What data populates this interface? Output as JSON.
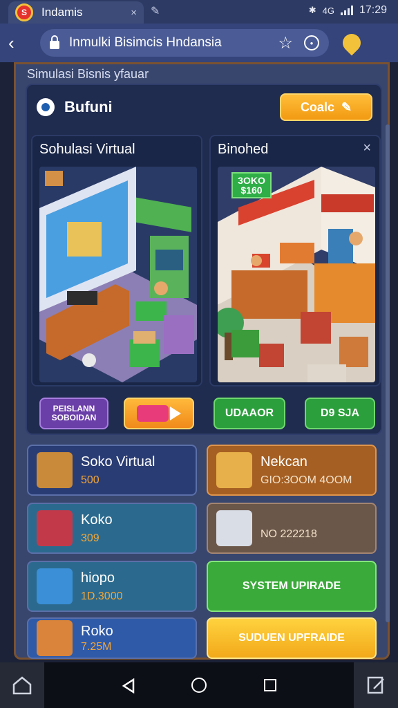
{
  "browser": {
    "tab_title": "Indamis",
    "tab_close": "×",
    "tab_favicon_letter": "S",
    "tab_extra_icon": "extension-icon",
    "url": "Inmulki Bisimcis Hndansia",
    "time": "17:29",
    "status_text": "4G"
  },
  "page": {
    "header_title": "Simulasi Bisnis yfauar",
    "brand_name": "Bufuni",
    "code_button": "Coalc",
    "left_panel_title": "Sohulasi Virtual",
    "right_panel_title": "Binohed",
    "right_panel_close": "×",
    "price_tag": [
      "3OKO",
      "$160"
    ],
    "buttons": {
      "purple_line1": "PEISLANN",
      "purple_line2": "SOBOIDAN",
      "green1": "UDAAOR",
      "green2": "D9 SJA"
    },
    "tiles": [
      {
        "name": "Soko Virtual",
        "value": "500",
        "value_color": "#f2a63a"
      },
      {
        "name": "Nekcan",
        "value": "GIO:3OOM 4OOM",
        "value_color": "#f3e0c8"
      },
      {
        "name": "Koko",
        "value": "309",
        "value_color": "#f2a63a"
      },
      {
        "name": "",
        "value": "NO 222218",
        "value_color": "#f3e0c8"
      },
      {
        "name": "hiopo",
        "value": "1D.3000",
        "value_color": "#f2a63a"
      },
      {
        "name": "SYSTEM UPIRADE",
        "value": ""
      },
      {
        "name": "Roko",
        "value": "7.25M",
        "value_color": "#f2a63a"
      },
      {
        "name": "SUDUEN UPFRAIDE",
        "value": ""
      }
    ]
  },
  "colors": {
    "accent_orange": "#f29a12",
    "accent_green": "#2c9f3d",
    "panel_bg": "#1f2b4f"
  }
}
